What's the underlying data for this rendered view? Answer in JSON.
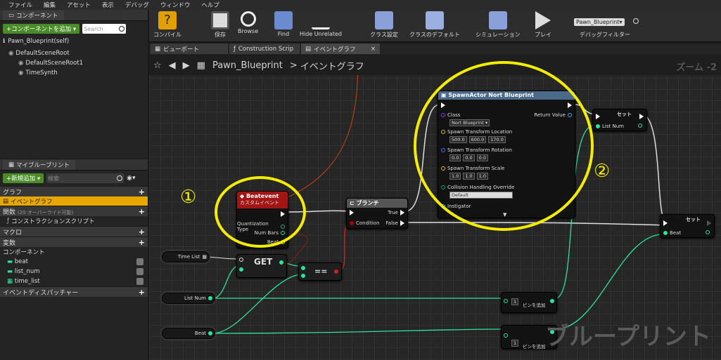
{
  "menu": [
    "ファイル",
    "編集",
    "アセット",
    "表示",
    "デバッグ",
    "ウィンドウ",
    "ヘルプ"
  ],
  "components_panel": {
    "tab": "コンポーネント",
    "add_button": "+コンポーネントを追加 ▾",
    "search_placeholder": "Search",
    "self": "Pawn_Blueprint(self)",
    "tree": [
      "DefaultSceneRoot",
      "DefaultSceneRoot1",
      "TimeSynth"
    ]
  },
  "mybp_panel": {
    "tab": "マイブループリント",
    "add_button": "+新規追加 ▾",
    "search_placeholder": "検索",
    "graph_cat": "グラフ",
    "event_graph": "イベントグラフ",
    "functions_cat": "関数",
    "functions_note": "(20 オーバーライド可能)",
    "construction": "コンストラクションスクリプト",
    "macro_cat": "マクロ",
    "vars_cat": "変数",
    "components_cat": "コンポーネント",
    "vars": [
      "beat",
      "list_num",
      "time_list"
    ],
    "dispatchers": "イベントディスパッチャー"
  },
  "toolbar": {
    "compile": "コンパイル",
    "save": "保存",
    "browse": "Browse",
    "find": "Find",
    "hide": "Hide Unrelated",
    "class_settings": "クラス設定",
    "class_defaults": "クラスのデフォルト",
    "simulate": "シミュレーション",
    "play": "プレイ",
    "debug_select": "Pawn_Blueprint▾",
    "debug_filter": "デバッグフィルター"
  },
  "doc_tabs": [
    "ビューポート",
    "Construction Scrip",
    "イベントグラフ"
  ],
  "breadcrumb": {
    "bp": "Pawn_Blueprint",
    "sep": ">",
    "graph": "イベントグラフ"
  },
  "zoom": "ズーム -2",
  "watermark": "ブループリント",
  "nodes": {
    "beat_event": {
      "title": "Beatevent",
      "subtitle": "カスタムイベント",
      "pins": [
        "Quantization Type",
        "Num Bars",
        "Beat"
      ]
    },
    "branch": {
      "title": "ブランチ",
      "condition": "Condition",
      "true": "True",
      "false": "False"
    },
    "get": {
      "label": "GET"
    },
    "eq": {
      "label": "=="
    },
    "spawn": {
      "title": "SpawnActor Nort Blueprint",
      "class": "Class",
      "class_value": "Nort Blueprint ▾",
      "return": "Return Value",
      "loc": "Spawn Transform Location",
      "loc_v": [
        "500.0",
        "600.0",
        "170.0"
      ],
      "rot": "Spawn Transform Rotation",
      "rot_v": [
        "0.0",
        "0.0",
        "0.0"
      ],
      "scale": "Spawn Transform Scale",
      "scale_v": [
        "1.0",
        "1.0",
        "1.0"
      ],
      "coll": "Collision Handling Override",
      "coll_v": "Default",
      "inst": "Instigator"
    },
    "set1": {
      "title": "セット",
      "pin": "List Num"
    },
    "set2": {
      "title": "セット",
      "pin": "Beat"
    },
    "vars": {
      "time_list": "Time List",
      "list_num": "List Num",
      "beat": "Beat"
    },
    "add1": {
      "label": "ピンを追加",
      "num": "1"
    },
    "add2": {
      "label": "ピンを追加",
      "num": "1"
    }
  },
  "callouts": [
    "①",
    "②"
  ]
}
